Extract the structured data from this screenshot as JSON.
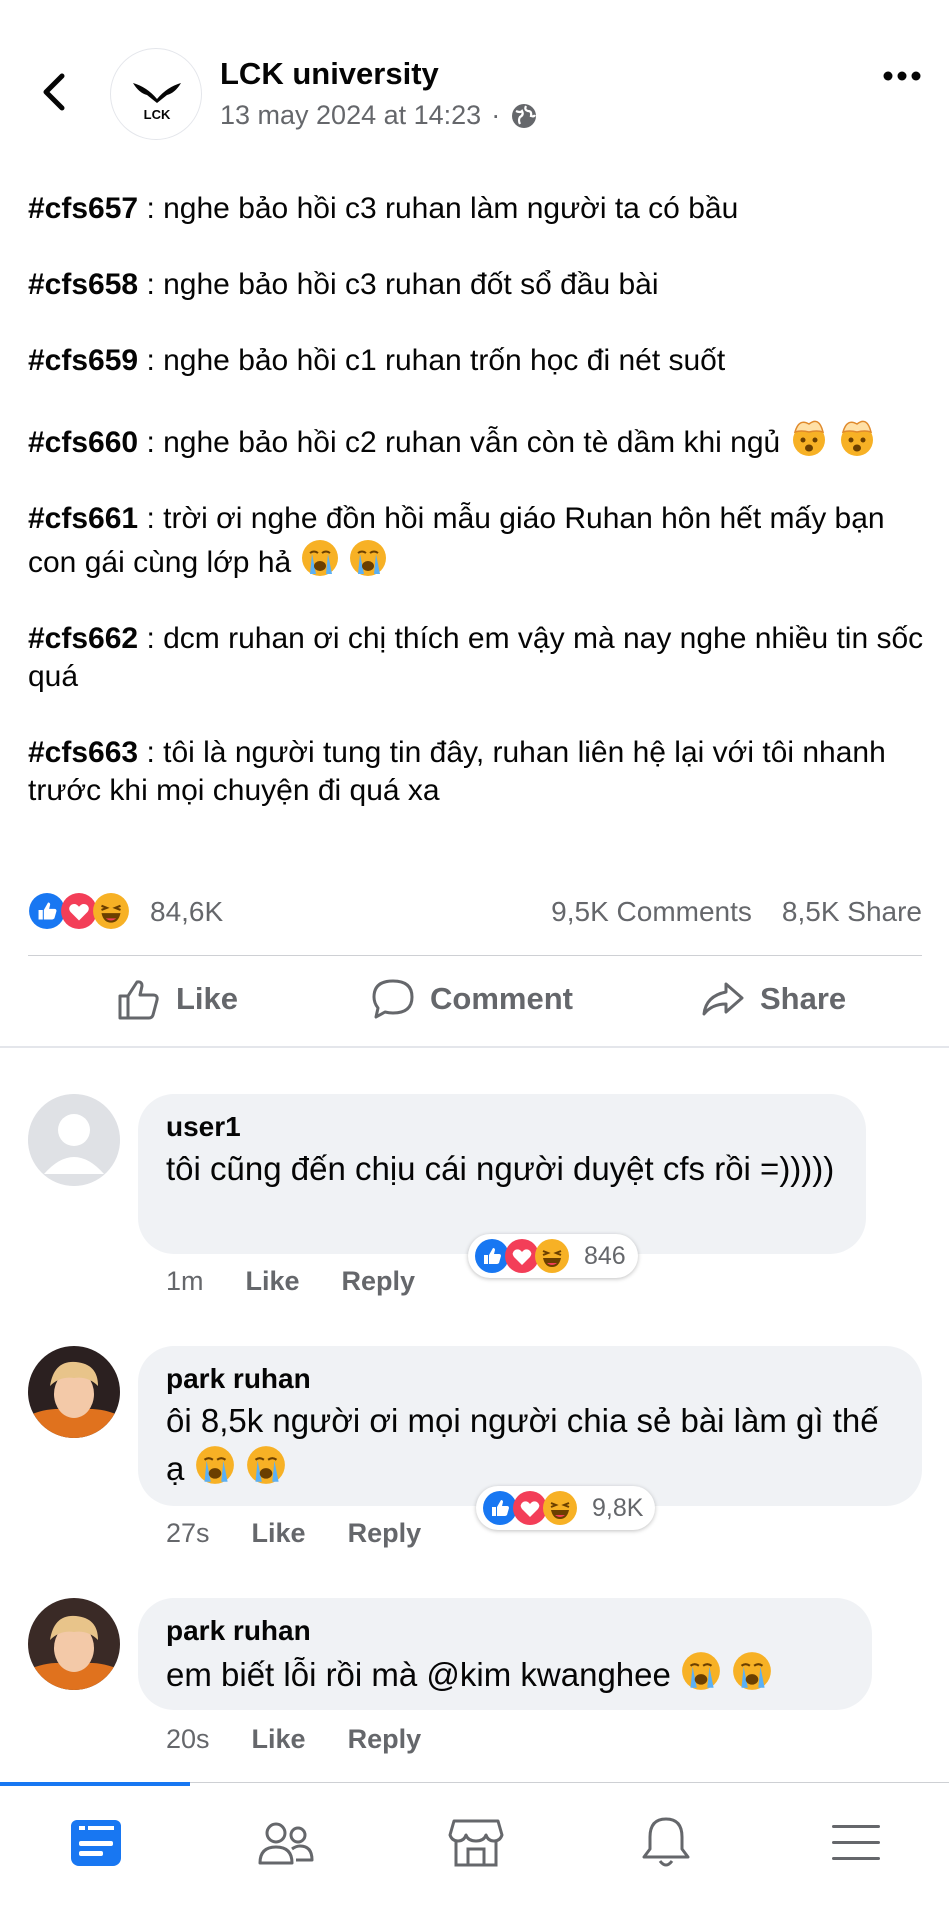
{
  "header": {
    "page_name": "LCK university",
    "timestamp": "13 may 2024 at 14:23",
    "separator": "·",
    "logo_text": "LCK"
  },
  "post": {
    "lines": [
      {
        "tag": "#cfs657",
        "text": " : nghe bảo hồi c3 ruhan làm người ta có bầu",
        "emoji": ""
      },
      {
        "tag": "#cfs658",
        "text": " : nghe bảo hồi c3 ruhan đốt sổ đầu bài",
        "emoji": ""
      },
      {
        "tag": "#cfs659",
        "text": " : nghe bảo hồi c1 ruhan trốn học đi nét suốt",
        "emoji": ""
      },
      {
        "tag": "#cfs660",
        "text": " : nghe bảo hồi c2 ruhan vẫn còn tè dầm khi ngủ",
        "emoji": "exploding-head x2"
      },
      {
        "tag": "#cfs661",
        "text": " : trời ơi nghe đồn hồi mẫu giáo Ruhan hôn hết mấy bạn con gái cùng lớp hả",
        "emoji": "crying x2"
      },
      {
        "tag": "#cfs662",
        "text": " : dcm ruhan ơi chị thích em vậy mà nay nghe nhiều tin sốc quá",
        "emoji": ""
      },
      {
        "tag": "#cfs663",
        "text": " : tôi là người tung tin đây, ruhan liên hệ lại với tôi nhanh trước khi mọi chuyện đi quá xa",
        "emoji": ""
      }
    ]
  },
  "stats": {
    "reactions": "84,6K",
    "comments": "9,5K Comments",
    "shares": "8,5K Share"
  },
  "actions": {
    "like": "Like",
    "comment": "Comment",
    "share": "Share"
  },
  "comments": [
    {
      "name": "user1",
      "text": "tôi cũng đến chịu cái người duyệt cfs rồi =)))))",
      "time": "1m",
      "like": "Like",
      "reply": "Reply",
      "reactions": "846"
    },
    {
      "name": "park ruhan",
      "text": "ôi 8,5k người ơi mọi người chia sẻ bài làm gì thế ạ",
      "time": "27s",
      "like": "Like",
      "reply": "Reply",
      "reactions": "9,8K"
    },
    {
      "name": "park ruhan",
      "text": "em biết lỗi rồi mà @kim kwanghee",
      "time": "20s",
      "like": "Like",
      "reply": "Reply",
      "reactions": ""
    }
  ],
  "colors": {
    "accent": "#1877f2",
    "like": "#1877f2",
    "love": "#f33e58",
    "haha": "#f7b125",
    "muted": "#65676b",
    "bubble": "#f0f2f5"
  },
  "icons": [
    "back-icon",
    "globe-icon",
    "more-icon",
    "like-icon",
    "comment-icon",
    "share-icon",
    "feed-icon",
    "friends-icon",
    "marketplace-icon",
    "bell-icon",
    "menu-icon"
  ]
}
